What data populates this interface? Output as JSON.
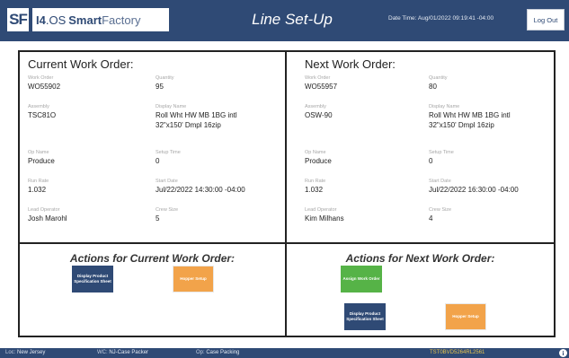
{
  "header": {
    "logo_sf": "SF",
    "logo_i4": "I4",
    "logo_os": ".OS",
    "logo_smart": "Smart",
    "logo_factory": "Factory",
    "title": "Line Set-Up",
    "datetime": "Date Time: Aug/01/2022 09:19:41 -04:00",
    "logout_label": "Log Out"
  },
  "current": {
    "title": "Current Work Order:",
    "fields": {
      "work_order": {
        "label": "Work Order",
        "value": "WO55902"
      },
      "quantity": {
        "label": "Quantity",
        "value": "95"
      },
      "assembly": {
        "label": "Assembly",
        "value": "TSC81O"
      },
      "display_name": {
        "label": "Display Name",
        "value_line1": "Roll Wht HW MB 1BG intl",
        "value_line2": "32\"x150' Dmpl 16zip"
      },
      "op_name": {
        "label": "Op Name",
        "value": "Produce"
      },
      "setup_time": {
        "label": "Setup Time",
        "value": "0"
      },
      "run_rate": {
        "label": "Run Rate",
        "value": "1.032"
      },
      "start_date": {
        "label": "Start Date",
        "value": "Jul/22/2022 14:30:00 -04:00"
      },
      "lead_operator": {
        "label": "Lead Operator",
        "value": "Josh Marohl"
      },
      "crew_size": {
        "label": "Crew Size",
        "value": "5"
      }
    }
  },
  "next": {
    "title": "Next Work Order:",
    "fields": {
      "work_order": {
        "label": "Work Order",
        "value": "WO55957"
      },
      "quantity": {
        "label": "Quantity",
        "value": "80"
      },
      "assembly": {
        "label": "Assembly",
        "value": "OSW-90"
      },
      "display_name": {
        "label": "Display Name",
        "value_line1": "Roll Wht HW MB 1BG intl",
        "value_line2": "32\"x150' Dmpl 16zip"
      },
      "op_name": {
        "label": "Op Name",
        "value": "Produce"
      },
      "setup_time": {
        "label": "Setup Time",
        "value": "0"
      },
      "run_rate": {
        "label": "Run Rate",
        "value": "1.032"
      },
      "start_date": {
        "label": "Start Date",
        "value": "Jul/22/2022 16:30:00 -04:00"
      },
      "lead_operator": {
        "label": "Lead Operator",
        "value": "Kim Milhans"
      },
      "crew_size": {
        "label": "Crew Size",
        "value": "4"
      }
    }
  },
  "actions_current": {
    "title": "Actions for Current Work Order:",
    "display_spec_label": "Display Product Specification Sheet",
    "hopper_setup_label": "Hopper Setup"
  },
  "actions_next": {
    "title": "Actions for Next Work Order:",
    "assign_label": "Assign Work Order",
    "display_spec_label": "Display Product Specification Sheet",
    "hopper_setup_label": "Hopper Setup"
  },
  "footer": {
    "loc_label": "Loc:",
    "loc_value": "New Jersey",
    "wc_label": "WC:",
    "wc_value": "NJ-Case Packer",
    "op_label": "Op:",
    "op_value": "Case Packing",
    "serial": "TST0BVD5264RL2561"
  },
  "colors": {
    "header_bg": "#2f4a75",
    "accent_orange": "#f2a34a",
    "accent_green": "#56b347",
    "accent_blue": "#2f4a75"
  },
  "icons": {
    "info": "info-icon"
  }
}
